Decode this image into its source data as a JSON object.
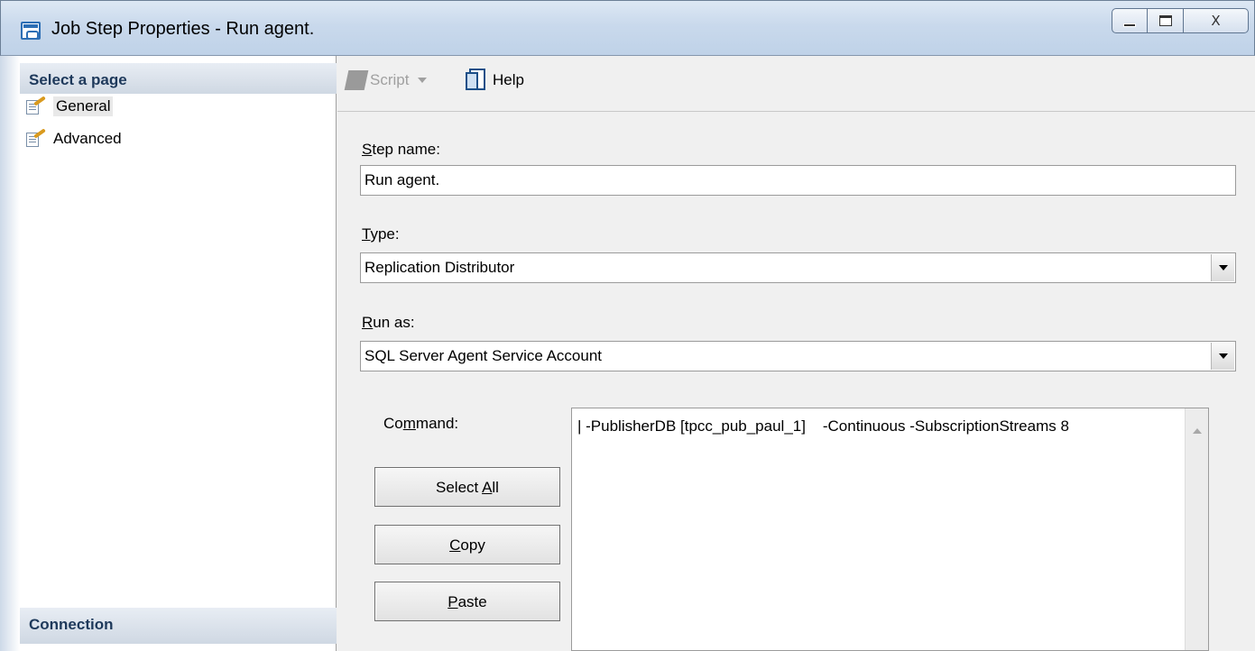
{
  "window": {
    "title": "Job Step Properties - Run agent.",
    "caption": {
      "minimize": "_",
      "maximize": "□",
      "close": "X"
    }
  },
  "sidebar": {
    "header": "Select a page",
    "items": [
      {
        "label": "General",
        "selected": true
      },
      {
        "label": "Advanced",
        "selected": false
      }
    ],
    "connection_header": "Connection"
  },
  "toolbar": {
    "script_label": "Script",
    "help_label": "Help"
  },
  "form": {
    "step_name": {
      "label_rest": "tep name:",
      "label_key": "S",
      "value": "Run agent."
    },
    "type": {
      "label_rest": "ype:",
      "label_key": "T",
      "value": "Replication Distributor"
    },
    "run_as": {
      "label_rest": "un as:",
      "label_key": "R",
      "value": "SQL Server Agent Service Account"
    },
    "command": {
      "label_pre": "Co",
      "label_key": "m",
      "label_post": "mand:",
      "value": "| -PublisherDB [tpcc_pub_paul_1]    -Continuous -SubscriptionStreams 8"
    },
    "buttons": {
      "select_all": {
        "pre": "Select ",
        "key": "A",
        "post": "ll"
      },
      "copy": {
        "pre": "",
        "key": "C",
        "post": "opy"
      },
      "paste": {
        "pre": "",
        "key": "P",
        "post": "aste"
      }
    }
  }
}
